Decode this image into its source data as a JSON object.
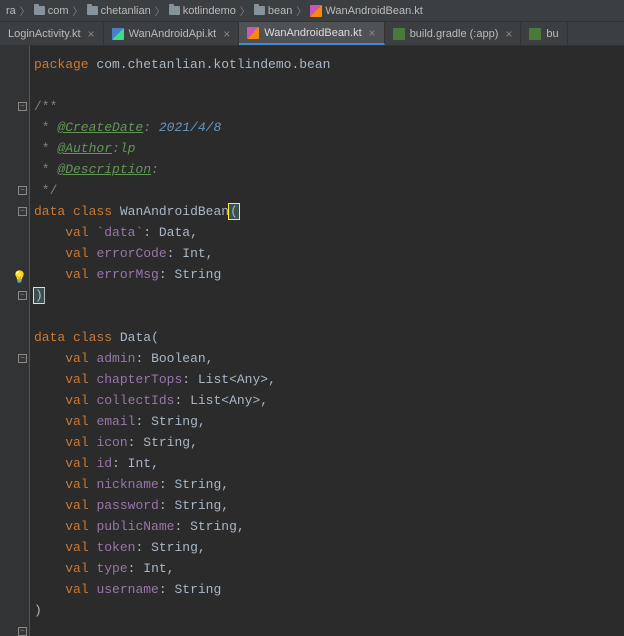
{
  "breadcrumb": {
    "items": [
      "ra",
      "com",
      "chetanlian",
      "kotlindemo",
      "bean",
      "WanAndroidBean.kt"
    ]
  },
  "tabs": {
    "items": [
      {
        "label": "LoginActivity.kt",
        "active": false
      },
      {
        "label": "WanAndroidApi.kt",
        "active": false
      },
      {
        "label": "WanAndroidBean.kt",
        "active": true
      },
      {
        "label": "build.gradle (:app)",
        "active": false
      },
      {
        "label": "bu",
        "active": false
      }
    ]
  },
  "code": {
    "package_kw": "package",
    "package_path": " com.chetanlian.kotlindemo.bean",
    "doc_open": "/**",
    "doc_star": " * ",
    "tag_createdate": "@CreateDate",
    "colon": ": ",
    "date": "2021/4/8",
    "tag_author": "@Author",
    "author_suffix": ":lp",
    "tag_description": "@Description",
    "desc_suffix": ":",
    "doc_close": " */",
    "data_kw": "data",
    "class_kw": "class",
    "val_kw": "val",
    "cls_wanandroid": "WanAndroidBean",
    "cls_data": "Data",
    "fld_data": "`data`",
    "fld_errorcode": "errorCode",
    "fld_errormsg": "errorMsg",
    "fld_admin": "admin",
    "fld_chaptertops": "chapterTops",
    "fld_collectids": "collectIds",
    "fld_email": "email",
    "fld_icon": "icon",
    "fld_id": "id",
    "fld_nickname": "nickname",
    "fld_password": "password",
    "fld_publicname": "publicName",
    "fld_token": "token",
    "fld_type": "type",
    "fld_username": "username",
    "ty_data": "Data",
    "ty_int": "Int",
    "ty_string": "String",
    "ty_boolean": "Boolean",
    "ty_listany": "List<Any>",
    "paren_open": "(",
    "paren_close": ")",
    "comma": ","
  }
}
